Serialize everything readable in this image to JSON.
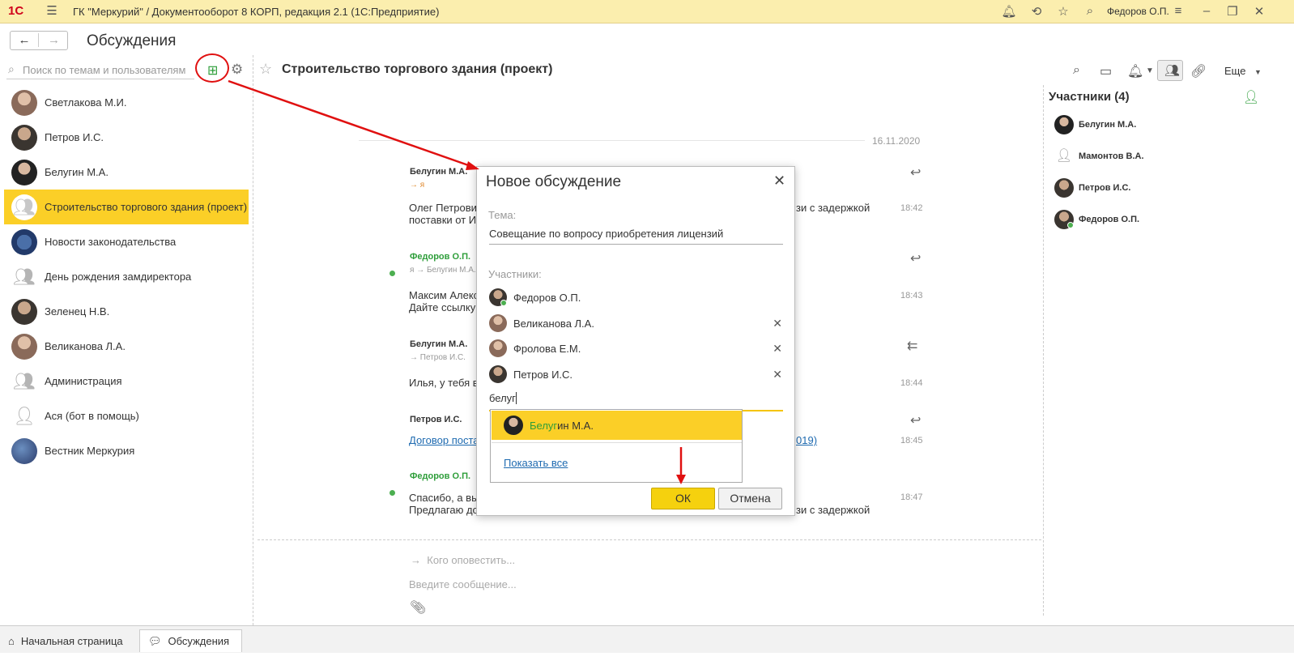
{
  "app": {
    "logo": "1С",
    "title": "ГК \"Меркурий\" / Документооборот 8 КОРП, редакция 2.1  (1С:Предприятие)",
    "user": "Федоров О.П."
  },
  "header": {
    "page_title": "Обсуждения"
  },
  "left": {
    "search_placeholder": "Поиск по темам и пользователям",
    "items": [
      {
        "label": "Светлакова М.И."
      },
      {
        "label": "Петров И.С."
      },
      {
        "label": "Белугин М.А."
      },
      {
        "label": "Строительство торгового здания (проект)"
      },
      {
        "label": "Новости законодательства"
      },
      {
        "label": "День рождения замдиректора"
      },
      {
        "label": "Зеленец Н.В."
      },
      {
        "label": "Великанова Л.А."
      },
      {
        "label": "Администрация"
      },
      {
        "label": "Ася (бот в помощь)"
      },
      {
        "label": "Вестник Меркурия"
      }
    ]
  },
  "chat": {
    "title": "Строительство торгового здания (проект)",
    "more": "Еще",
    "date": "16.11.2020",
    "messages": [
      {
        "name": "Белугин М.А.",
        "sub": "→ я",
        "text1": "Олег Петрович",
        "text2": "поставки от Ин",
        "tail1": "зи с задержкой",
        "time": "18:42"
      },
      {
        "name": "Федоров О.П.",
        "sub": "я → Белугин М.А.",
        "text1": "Максим Алекс",
        "text2": "Дайте ссылку",
        "time": "18:43"
      },
      {
        "name": "Белугин М.А.",
        "sub": "→ Петров И.С.",
        "text1": "Илья, у тебя в",
        "time": "18:44"
      },
      {
        "name": "Петров И.С.",
        "link1": "Договор поста",
        "link2": "019)",
        "time": "18:45"
      },
      {
        "name": "Федоров О.П.",
        "text1": "Спасибо, а вы",
        "text2": "Предлагаю до",
        "tail2": "зи с задержкой",
        "time": "18:47"
      }
    ],
    "compose_notify": "Кого оповестить...",
    "compose_placeholder": "Введите сообщение..."
  },
  "members": {
    "title": "Участники (4)",
    "list": [
      "Белугин М.А.",
      "Мамонтов В.А.",
      "Петров И.С.",
      "Федоров О.П."
    ]
  },
  "dialog": {
    "title": "Новое обсуждение",
    "topic_label": "Тема:",
    "topic_value": "Совещание по вопросу приобретения лицензий",
    "participants_label": "Участники:",
    "participants": [
      "Федоров О.П.",
      "Великанова Л.А.",
      "Фролова Е.М.",
      "Петров И.С."
    ],
    "typed": "белуг",
    "suggestion_match": "Белуг",
    "suggestion_rest": "ин М.А.",
    "show_all": "Показать все",
    "ok": "ОК",
    "cancel": "Отмена"
  },
  "taskbar": {
    "home": "Начальная страница",
    "discussions": "Обсуждения"
  },
  "colors": {
    "topbar": "#fbeeae",
    "accent": "#fbcf27",
    "online": "#4caf50",
    "annotation": "#e01010",
    "link": "#1e6ab0",
    "green_name": "#2e9e3a"
  }
}
